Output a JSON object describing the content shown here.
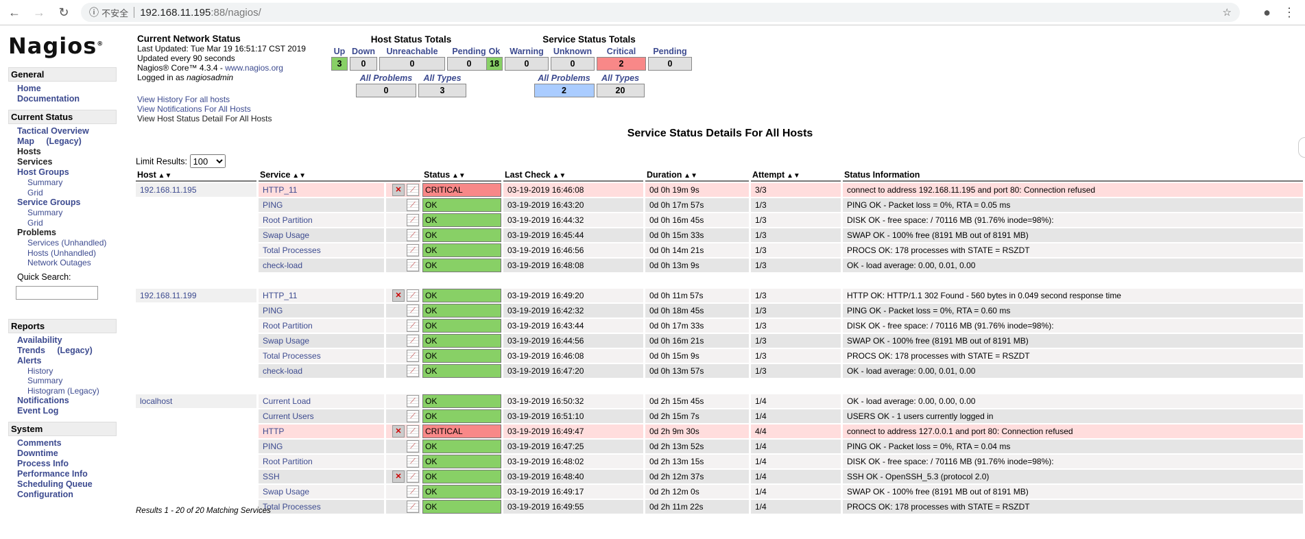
{
  "browser": {
    "security": "不安全",
    "url_host": "192.168.11.195",
    "url_rest": ":88/nagios/"
  },
  "logo": "Nagios",
  "sidebar": [
    {
      "title": "General",
      "items": [
        {
          "label": "Home",
          "level": 1
        },
        {
          "label": "Documentation",
          "level": 1
        }
      ]
    },
    {
      "title": "Current Status",
      "items": [
        {
          "label": "Tactical Overview",
          "level": 1
        },
        {
          "label": "Map     (Legacy)",
          "level": 1
        },
        {
          "label": "Hosts",
          "level": 1,
          "dark": true
        },
        {
          "label": "Services",
          "level": 1,
          "dark": true
        },
        {
          "label": "Host Groups",
          "level": 1
        },
        {
          "label": "Summary",
          "level": 2
        },
        {
          "label": "Grid",
          "level": 2
        },
        {
          "label": "Service Groups",
          "level": 1
        },
        {
          "label": "Summary",
          "level": 2
        },
        {
          "label": "Grid",
          "level": 2
        },
        {
          "label": "Problems",
          "level": 1,
          "dark": true
        },
        {
          "label": "Services (Unhandled)",
          "level": 2
        },
        {
          "label": "Hosts (Unhandled)",
          "level": 2
        },
        {
          "label": "Network Outages",
          "level": 2
        }
      ],
      "quick_search": "Quick Search:"
    },
    {
      "title": "Reports",
      "items": [
        {
          "label": "Availability",
          "level": 1
        },
        {
          "label": "Trends     (Legacy)",
          "level": 1
        },
        {
          "label": "Alerts",
          "level": 1
        },
        {
          "label": "History",
          "level": 2
        },
        {
          "label": "Summary",
          "level": 2
        },
        {
          "label": "Histogram (Legacy)",
          "level": 2
        },
        {
          "label": "Notifications",
          "level": 1
        },
        {
          "label": "Event Log",
          "level": 1
        }
      ]
    },
    {
      "title": "System",
      "items": [
        {
          "label": "Comments",
          "level": 1
        },
        {
          "label": "Downtime",
          "level": 1
        },
        {
          "label": "Process Info",
          "level": 1
        },
        {
          "label": "Performance Info",
          "level": 1
        },
        {
          "label": "Scheduling Queue",
          "level": 1
        },
        {
          "label": "Configuration",
          "level": 1
        }
      ]
    }
  ],
  "info": {
    "title": "Current Network Status",
    "last_updated": "Last Updated: Tue Mar 19 16:51:17 CST 2019",
    "interval": "Updated every 90 seconds",
    "version": "Nagios® Core™ 4.3.4 - ",
    "site": "www.nagios.org",
    "logged_prefix": "Logged in as ",
    "user": "nagiosadmin",
    "links": [
      "View History For all hosts",
      "View Notifications For All Hosts",
      "View Host Status Detail For All Hosts"
    ]
  },
  "host_totals": {
    "title": "Host Status Totals",
    "labels": [
      "Up",
      "Down",
      "Unreachable",
      "Pending"
    ],
    "values": [
      "3",
      "0",
      "0",
      "0"
    ],
    "sub_labels": [
      "All Problems",
      "All Types"
    ],
    "sub_values": [
      "0",
      "3"
    ]
  },
  "service_totals": {
    "title": "Service Status Totals",
    "labels": [
      "Ok",
      "Warning",
      "Unknown",
      "Critical",
      "Pending"
    ],
    "values": [
      "18",
      "0",
      "0",
      "2",
      "0"
    ],
    "sub_labels": [
      "All Problems",
      "All Types"
    ],
    "sub_values": [
      "2",
      "20"
    ]
  },
  "page_title": "Service Status Details For All Hosts",
  "limit": {
    "label": "Limit Results:",
    "value": "100"
  },
  "columns": [
    "Host",
    "Service",
    "Status",
    "Last Check",
    "Duration",
    "Attempt",
    "Status Information"
  ],
  "colors": {
    "ok": "#88d066",
    "critical": "#f88888",
    "problems": "#aaccff"
  },
  "hosts": [
    {
      "host": "192.168.11.195",
      "services": [
        {
          "name": "HTTP_11",
          "status": "CRITICAL",
          "last": "03-19-2019 16:46:08",
          "dur": "0d 0h 19m 9s",
          "att": "3/3",
          "info": "connect to address 192.168.11.195 and port 80: Connection refused",
          "noti_off": true
        },
        {
          "name": "PING",
          "status": "OK",
          "last": "03-19-2019 16:43:20",
          "dur": "0d 0h 17m 57s",
          "att": "1/3",
          "info": "PING OK - Packet loss = 0%, RTA = 0.05 ms"
        },
        {
          "name": "Root Partition",
          "status": "OK",
          "last": "03-19-2019 16:44:32",
          "dur": "0d 0h 16m 45s",
          "att": "1/3",
          "info": "DISK OK - free space: / 70116 MB (91.76% inode=98%):"
        },
        {
          "name": "Swap Usage",
          "status": "OK",
          "last": "03-19-2019 16:45:44",
          "dur": "0d 0h 15m 33s",
          "att": "1/3",
          "info": "SWAP OK - 100% free (8191 MB out of 8191 MB)"
        },
        {
          "name": "Total Processes",
          "status": "OK",
          "last": "03-19-2019 16:46:56",
          "dur": "0d 0h 14m 21s",
          "att": "1/3",
          "info": "PROCS OK: 178 processes with STATE = RSZDT"
        },
        {
          "name": "check-load",
          "status": "OK",
          "last": "03-19-2019 16:48:08",
          "dur": "0d 0h 13m 9s",
          "att": "1/3",
          "info": "OK - load average: 0.00, 0.01, 0.00"
        }
      ]
    },
    {
      "host": "192.168.11.199",
      "services": [
        {
          "name": "HTTP_11",
          "status": "OK",
          "last": "03-19-2019 16:49:20",
          "dur": "0d 0h 11m 57s",
          "att": "1/3",
          "info": "HTTP OK: HTTP/1.1 302 Found - 560 bytes in 0.049 second response time",
          "noti_off": true
        },
        {
          "name": "PING",
          "status": "OK",
          "last": "03-19-2019 16:42:32",
          "dur": "0d 0h 18m 45s",
          "att": "1/3",
          "info": "PING OK - Packet loss = 0%, RTA = 0.60 ms"
        },
        {
          "name": "Root Partition",
          "status": "OK",
          "last": "03-19-2019 16:43:44",
          "dur": "0d 0h 17m 33s",
          "att": "1/3",
          "info": "DISK OK - free space: / 70116 MB (91.76% inode=98%):"
        },
        {
          "name": "Swap Usage",
          "status": "OK",
          "last": "03-19-2019 16:44:56",
          "dur": "0d 0h 16m 21s",
          "att": "1/3",
          "info": "SWAP OK - 100% free (8191 MB out of 8191 MB)"
        },
        {
          "name": "Total Processes",
          "status": "OK",
          "last": "03-19-2019 16:46:08",
          "dur": "0d 0h 15m 9s",
          "att": "1/3",
          "info": "PROCS OK: 178 processes with STATE = RSZDT"
        },
        {
          "name": "check-load",
          "status": "OK",
          "last": "03-19-2019 16:47:20",
          "dur": "0d 0h 13m 57s",
          "att": "1/3",
          "info": "OK - load average: 0.00, 0.01, 0.00"
        }
      ]
    },
    {
      "host": "localhost",
      "services": [
        {
          "name": "Current Load",
          "status": "OK",
          "last": "03-19-2019 16:50:32",
          "dur": "0d 2h 15m 45s",
          "att": "1/4",
          "info": "OK - load average: 0.00, 0.00, 0.00"
        },
        {
          "name": "Current Users",
          "status": "OK",
          "last": "03-19-2019 16:51:10",
          "dur": "0d 2h 15m 7s",
          "att": "1/4",
          "info": "USERS OK - 1 users currently logged in"
        },
        {
          "name": "HTTP",
          "status": "CRITICAL",
          "last": "03-19-2019 16:49:47",
          "dur": "0d 2h 9m 30s",
          "att": "4/4",
          "info": "connect to address 127.0.0.1 and port 80: Connection refused",
          "noti_off": true
        },
        {
          "name": "PING",
          "status": "OK",
          "last": "03-19-2019 16:47:25",
          "dur": "0d 2h 13m 52s",
          "att": "1/4",
          "info": "PING OK - Packet loss = 0%, RTA = 0.04 ms"
        },
        {
          "name": "Root Partition",
          "status": "OK",
          "last": "03-19-2019 16:48:02",
          "dur": "0d 2h 13m 15s",
          "att": "1/4",
          "info": "DISK OK - free space: / 70116 MB (91.76% inode=98%):"
        },
        {
          "name": "SSH",
          "status": "OK",
          "last": "03-19-2019 16:48:40",
          "dur": "0d 2h 12m 37s",
          "att": "1/4",
          "info": "SSH OK - OpenSSH_5.3 (protocol 2.0)",
          "noti_off": true
        },
        {
          "name": "Swap Usage",
          "status": "OK",
          "last": "03-19-2019 16:49:17",
          "dur": "0d 2h 12m 0s",
          "att": "1/4",
          "info": "SWAP OK - 100% free (8191 MB out of 8191 MB)"
        },
        {
          "name": "Total Processes",
          "status": "OK",
          "last": "03-19-2019 16:49:55",
          "dur": "0d 2h 11m 22s",
          "att": "1/4",
          "info": "PROCS OK: 178 processes with STATE = RSZDT"
        }
      ]
    }
  ],
  "footer": "Results 1 - 20 of 20 Matching Services"
}
